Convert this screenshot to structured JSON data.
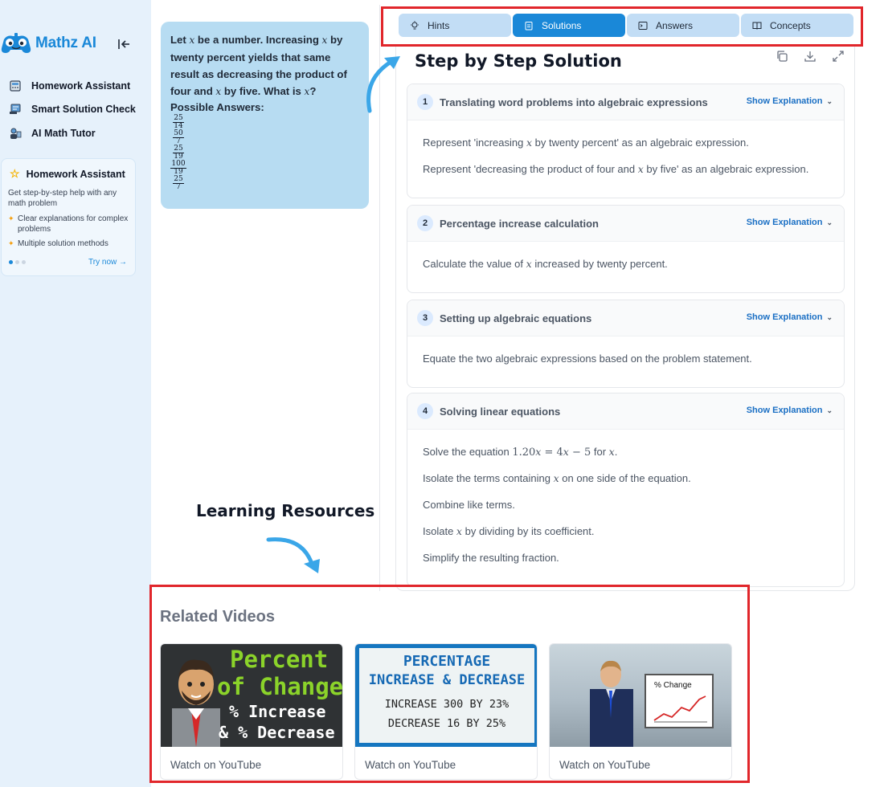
{
  "app": {
    "name": "Mathz AI",
    "logo_icon": "gamepad-logo-icon",
    "collapse_icon": "collapse-sidebar-icon"
  },
  "sidebar": {
    "items": [
      {
        "label": "Homework Assistant",
        "icon": "calculator-icon"
      },
      {
        "label": "Smart Solution Check",
        "icon": "checklist-icon"
      },
      {
        "label": "AI Math Tutor",
        "icon": "tutor-icon"
      }
    ],
    "promo": {
      "title": "Homework Assistant",
      "description": "Get step-by-step help with any math problem",
      "bullets": [
        "Clear explanations for complex problems",
        "Multiple solution methods"
      ],
      "cta": "Try now →",
      "active_dot": 1,
      "dot_count": 3
    }
  },
  "question": {
    "line1_a": "Let ",
    "var": "x",
    "line1_b": " be a number. Increasing ",
    "line2": " by twenty percent yields that same result as decreasing the product of four and ",
    "line3": " by five. What is ",
    "line3_end": "?",
    "possible_label": "Possible Answers:",
    "answers": [
      {
        "num": "25",
        "den": "14"
      },
      {
        "num": "50",
        "den": "7"
      },
      {
        "num": "25",
        "den": "19"
      },
      {
        "num": "100",
        "den": "19"
      },
      {
        "num": "25",
        "den": "7"
      }
    ]
  },
  "tabs": [
    {
      "label": "Hints",
      "icon": "lightbulb-icon",
      "active": false
    },
    {
      "label": "Solutions",
      "icon": "clipboard-icon",
      "active": true
    },
    {
      "label": "Answers",
      "icon": "terminal-icon",
      "active": false
    },
    {
      "label": "Concepts",
      "icon": "book-icon",
      "active": false
    }
  ],
  "solution": {
    "heading": "Step by Step Solution",
    "tools": [
      "copy-icon",
      "download-icon",
      "expand-icon"
    ],
    "show_explanation": "Show Explanation",
    "steps": [
      {
        "number": "1",
        "title": "Translating word problems into algebraic expressions",
        "lines": [
          [
            "Represent 'increasing ",
            {
              "v": "x"
            },
            " by twenty percent' as an algebraic expression."
          ],
          [
            "Represent 'decreasing the product of four and ",
            {
              "v": "x"
            },
            " by five' as an algebraic expression."
          ]
        ]
      },
      {
        "number": "2",
        "title": "Percentage increase calculation",
        "lines": [
          [
            "Calculate the value of ",
            {
              "v": "x"
            },
            " increased by twenty percent."
          ]
        ]
      },
      {
        "number": "3",
        "title": "Setting up algebraic equations",
        "lines": [
          [
            "Equate the two algebraic expressions based on the problem statement."
          ]
        ]
      },
      {
        "number": "4",
        "title": "Solving linear equations",
        "lines": [
          [
            "Solve the equation ",
            {
              "m": "1.20"
            },
            {
              "v": "x"
            },
            {
              "m": " = 4"
            },
            {
              "v": "x"
            },
            {
              "m": " − 5"
            },
            " for ",
            {
              "v": "x"
            },
            "."
          ],
          [
            "Isolate the terms containing ",
            {
              "v": "x"
            },
            " on one side of the equation."
          ],
          [
            "Combine like terms."
          ],
          [
            "Isolate ",
            {
              "v": "x"
            },
            " by dividing by its coefficient."
          ],
          [
            "Simplify the resulting fraction."
          ]
        ]
      }
    ]
  },
  "annotations": {
    "learning_resources": "Learning Resources"
  },
  "videos": {
    "heading": "Related Videos",
    "items": [
      {
        "watch": "Watch on YouTube",
        "thumb_lines": [
          "Percent",
          "of Change",
          "% Increase",
          "& % Decrease"
        ]
      },
      {
        "watch": "Watch on YouTube",
        "thumb_lines": [
          "PERCENTAGE",
          "INCREASE & DECREASE",
          "INCREASE 300 BY 23%",
          "DECREASE 16 BY 25%"
        ]
      },
      {
        "watch": "Watch on YouTube",
        "thumb_lines": [
          "% Change"
        ]
      }
    ]
  },
  "colors": {
    "accent": "#1a88d8",
    "tab_inactive": "#c2ddf5",
    "question_card": "#b7dcf2",
    "sidebar_bg": "#e6f1fb",
    "highlight_box": "#e1262b",
    "thumb1_text": "#8bd32a"
  }
}
